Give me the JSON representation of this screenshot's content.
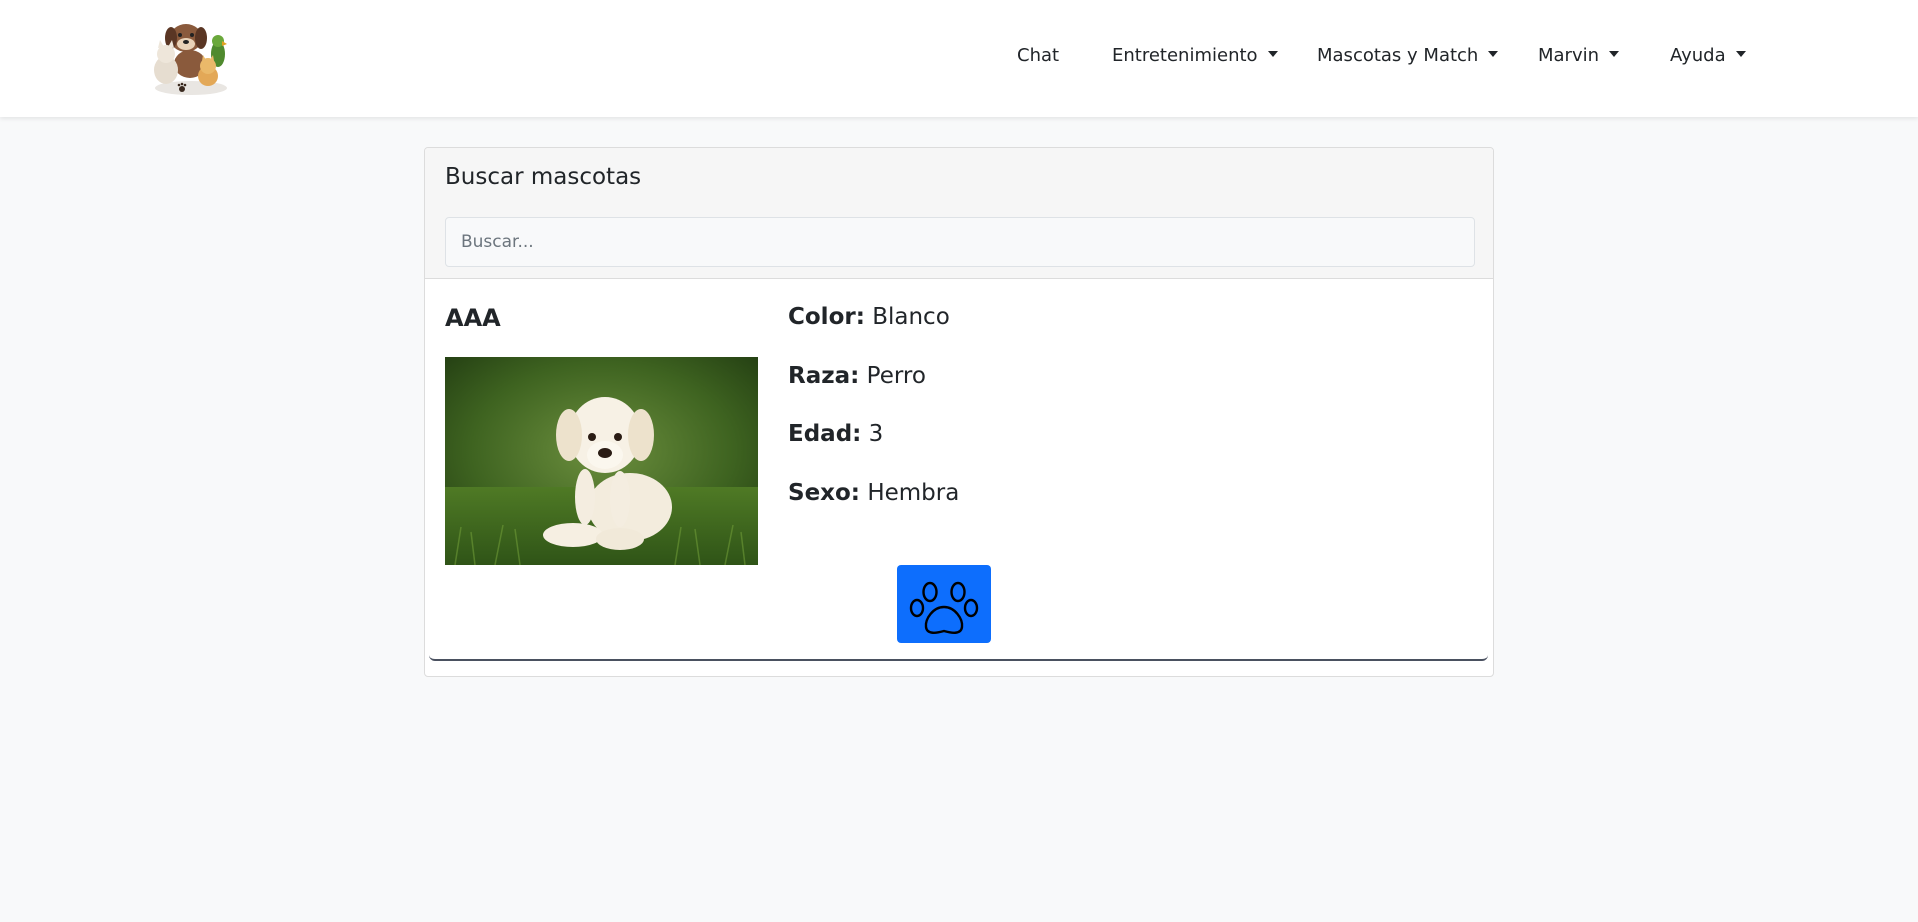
{
  "navbar": {
    "logo_icon": "pets-logo-icon",
    "items": [
      {
        "label": "Chat",
        "dropdown": false
      },
      {
        "label": "Entretenimiento",
        "dropdown": true
      },
      {
        "label": "Mascotas y Match",
        "dropdown": true
      },
      {
        "label": "Marvin",
        "dropdown": true
      },
      {
        "label": "Ayuda",
        "dropdown": true
      }
    ]
  },
  "search": {
    "title": "Buscar mascotas",
    "placeholder": "Buscar...",
    "value": ""
  },
  "pet": {
    "name": "AAA",
    "photo_icon": "puppy-photo",
    "attributes": [
      {
        "label": "Color:",
        "value": "Blanco"
      },
      {
        "label": "Raza:",
        "value": "Perro"
      },
      {
        "label": "Edad:",
        "value": "3"
      },
      {
        "label": "Sexo:",
        "value": "Hembra"
      }
    ],
    "match_button_icon": "paw-icon"
  },
  "colors": {
    "accent": "#0d6efd",
    "background": "#f8f9fa"
  }
}
